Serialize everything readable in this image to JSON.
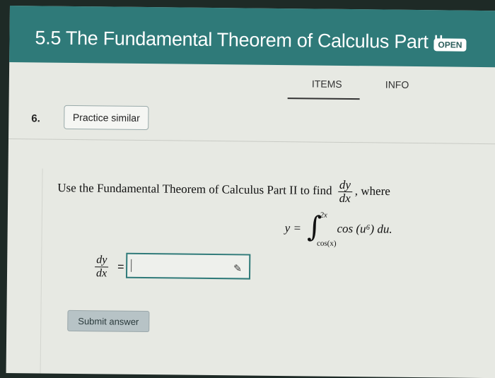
{
  "header": {
    "title": "5.5 The Fundamental Theorem of Calculus Part II",
    "badge": "OPEN"
  },
  "tabs": [
    {
      "label": "ITEMS"
    },
    {
      "label": "INFO"
    }
  ],
  "question": {
    "number": "6.",
    "practice_label": "Practice similar",
    "prompt_prefix": "Use the Fundamental Theorem of Calculus Part II to find",
    "dy": "dy",
    "dx": "dx",
    "prompt_suffix": ", where",
    "equation": {
      "lhs": "y =",
      "upper": "2x",
      "lower": "cos(x)",
      "integrand": "cos (u⁶) du."
    },
    "answer_label_num": "dy",
    "answer_label_den": "dx",
    "answer_eq": "=",
    "answer_value": "",
    "submit_label": "Submit answer"
  },
  "icons": {
    "edit": "pencil-icon"
  }
}
